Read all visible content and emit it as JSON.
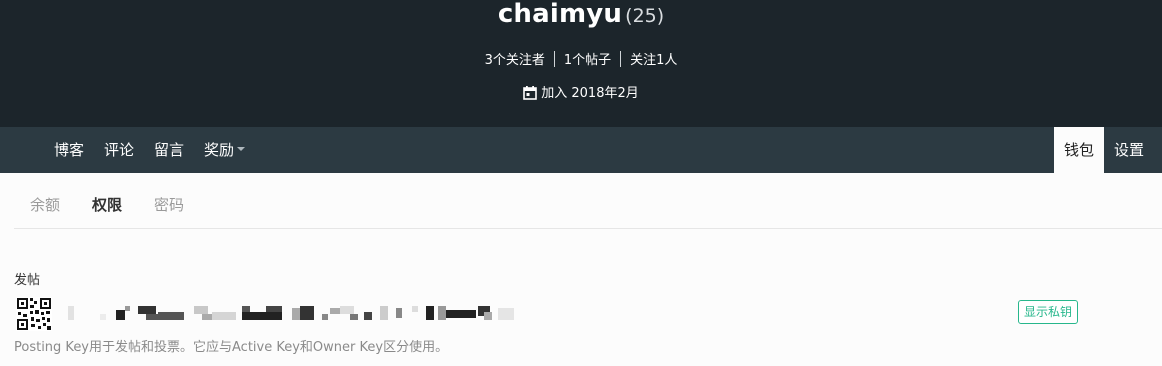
{
  "profile": {
    "username": "chaimyu",
    "reputation": "(25)",
    "followers": "3个关注者",
    "posts": "1个帖子",
    "following": "关注1人",
    "joined": "加入 2018年2月"
  },
  "nav": {
    "left_items": [
      "博客",
      "评论",
      "留言",
      "奖励"
    ],
    "wallet": "钱包",
    "settings": "设置"
  },
  "wallet_tabs": [
    "余额",
    "权限",
    "密码"
  ],
  "permission": {
    "title": "发帖",
    "reveal_button": "显示私钥",
    "description": "Posting Key用于发帖和投票。它应与Active Key和Owner Key区分使用。"
  },
  "icons": {
    "calendar": "calendar-icon",
    "qr": "qr-code-icon",
    "dropdown": "caret-down-icon"
  },
  "colors": {
    "header_bg": "#1c252b",
    "nav_bg": "#2c3a42",
    "accent": "#27b78c"
  }
}
